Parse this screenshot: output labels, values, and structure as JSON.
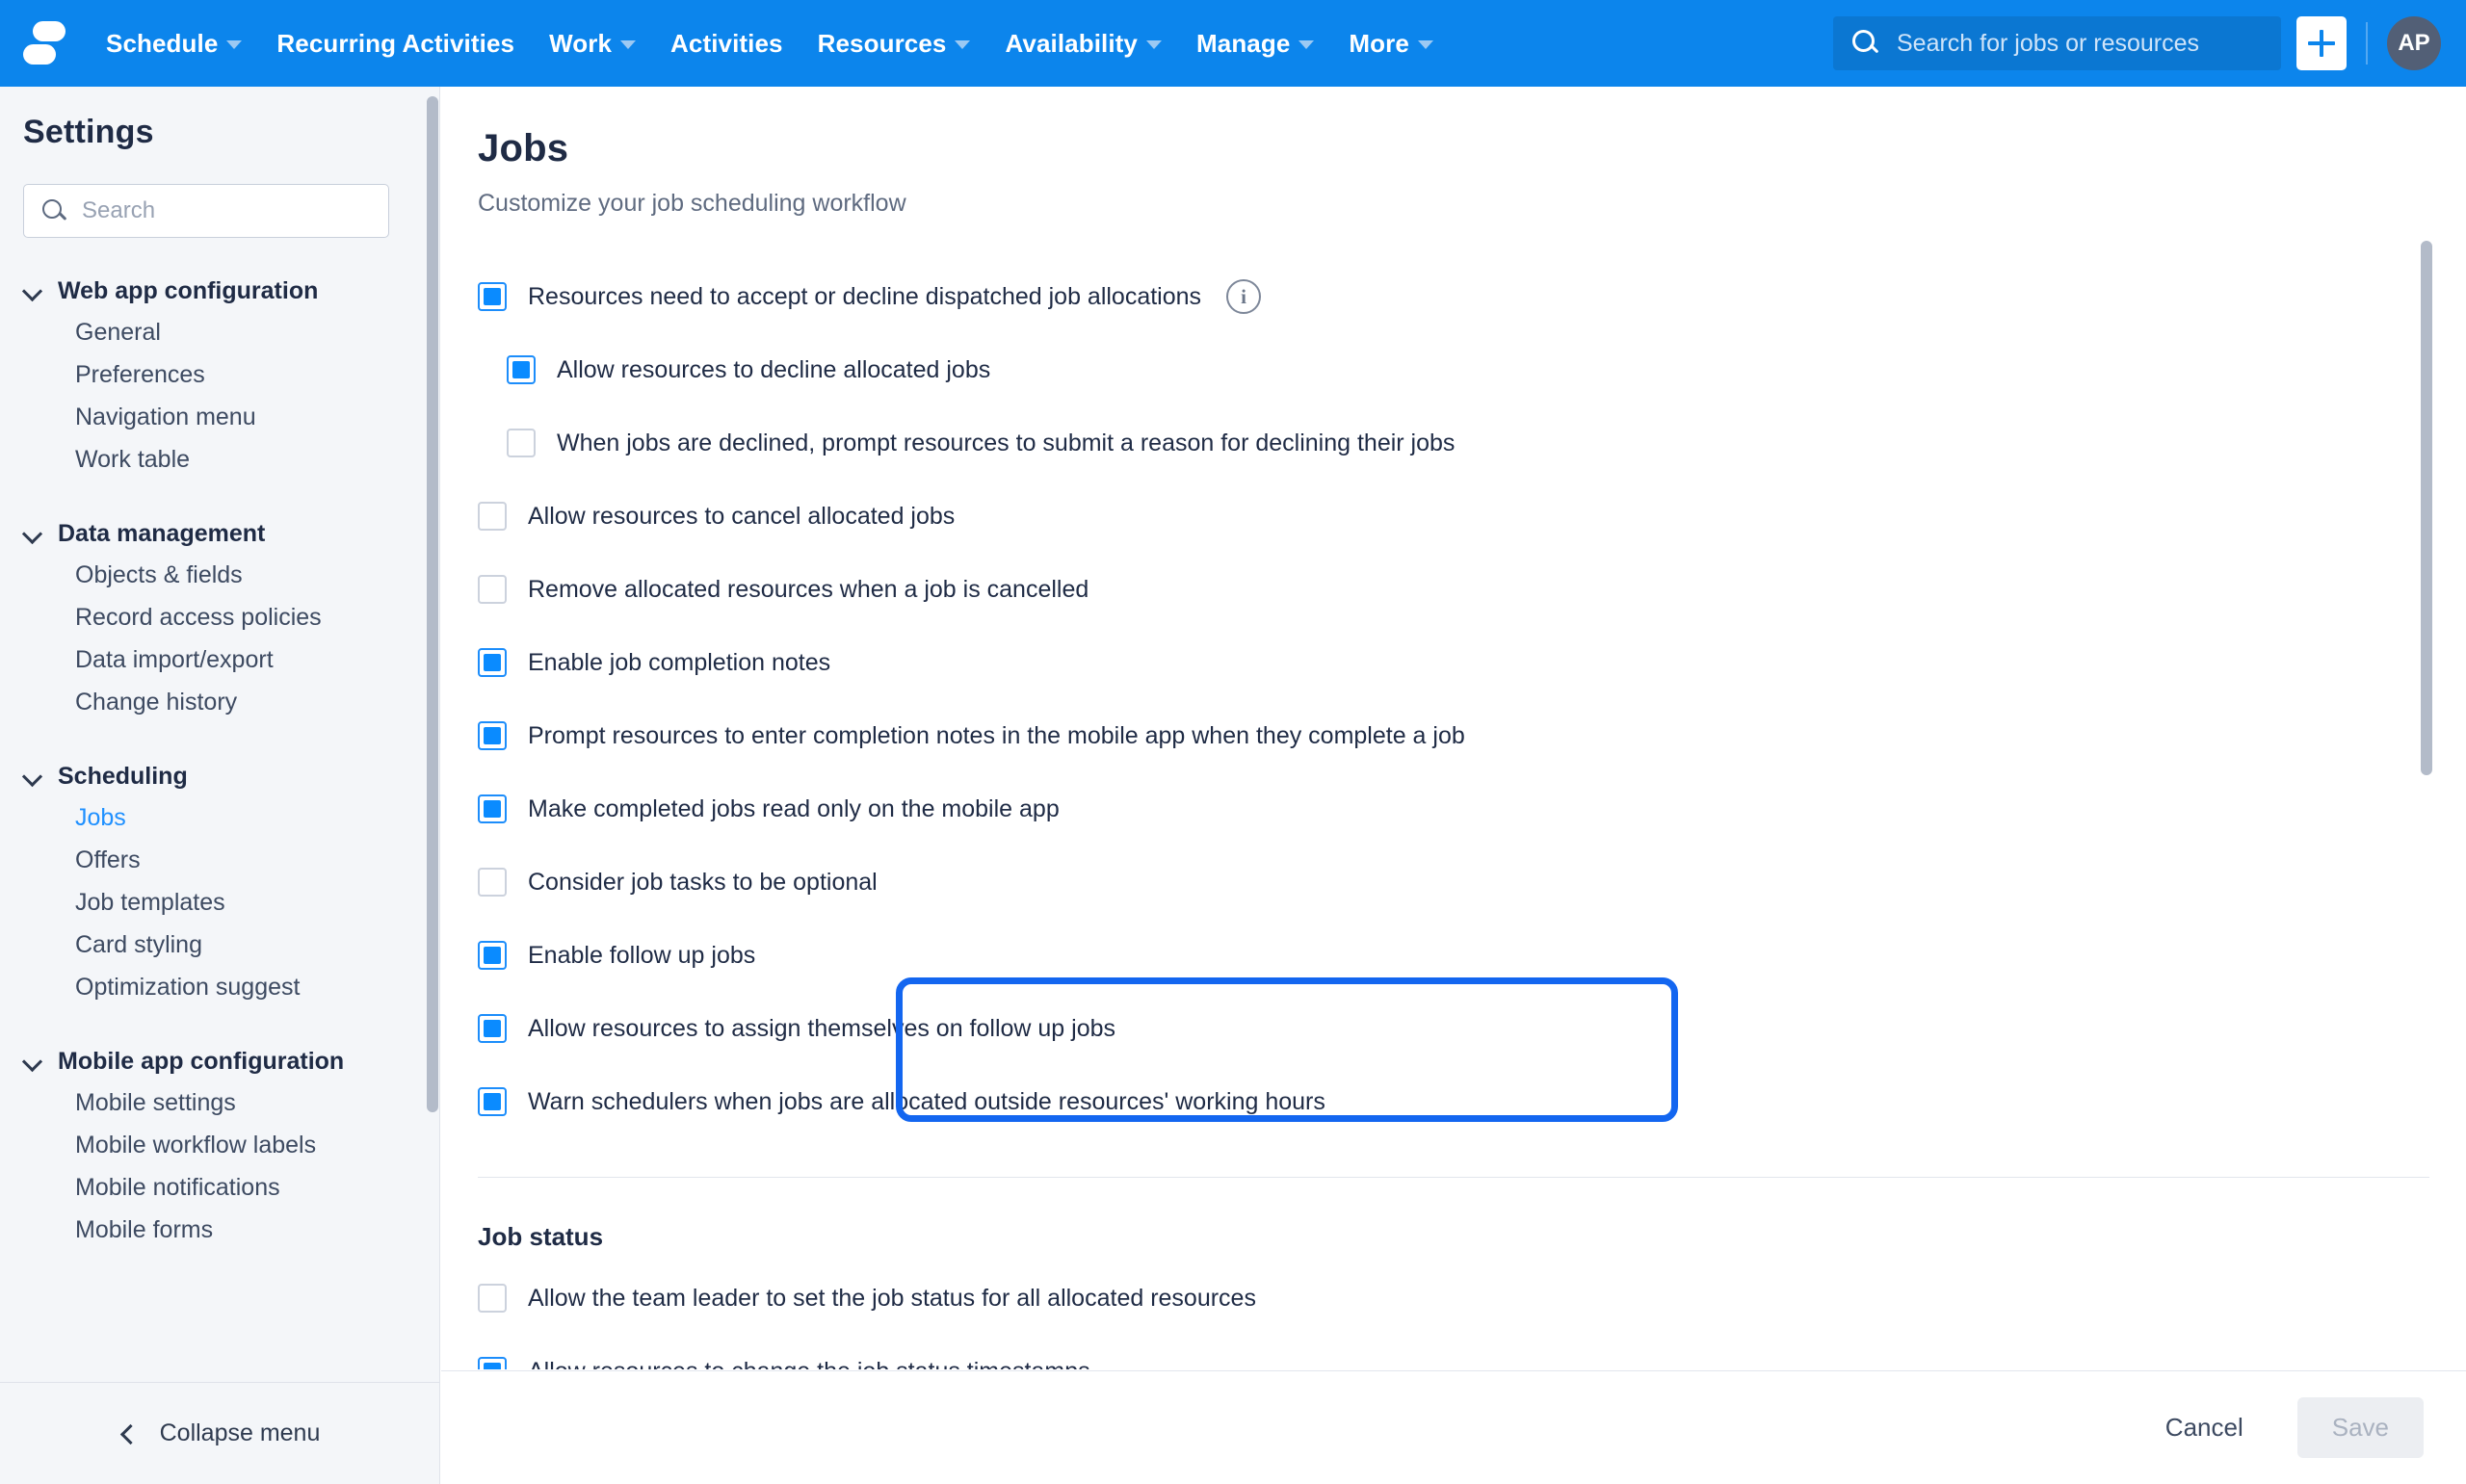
{
  "topnav": {
    "logo_name": "skedulo-logo",
    "items": [
      {
        "label": "Schedule",
        "has_caret": true
      },
      {
        "label": "Recurring Activities",
        "has_caret": false
      },
      {
        "label": "Work",
        "has_caret": true
      },
      {
        "label": "Activities",
        "has_caret": false
      },
      {
        "label": "Resources",
        "has_caret": true
      },
      {
        "label": "Availability",
        "has_caret": true
      },
      {
        "label": "Manage",
        "has_caret": true
      },
      {
        "label": "More",
        "has_caret": true
      }
    ],
    "search_placeholder": "Search for jobs or resources",
    "search_value": "",
    "add_button_label": "+",
    "avatar_initials": "AP",
    "brand_color": "#0c85ec"
  },
  "sidebar": {
    "title": "Settings",
    "search_placeholder": "Search",
    "search_value": "",
    "groups": [
      {
        "label": "Web app configuration",
        "items": [
          {
            "label": "General",
            "active": false
          },
          {
            "label": "Preferences",
            "active": false
          },
          {
            "label": "Navigation menu",
            "active": false
          },
          {
            "label": "Work table",
            "active": false
          }
        ]
      },
      {
        "label": "Data management",
        "items": [
          {
            "label": "Objects & fields",
            "active": false
          },
          {
            "label": "Record access policies",
            "active": false
          },
          {
            "label": "Data import/export",
            "active": false
          },
          {
            "label": "Change history",
            "active": false
          }
        ]
      },
      {
        "label": "Scheduling",
        "items": [
          {
            "label": "Jobs",
            "active": true
          },
          {
            "label": "Offers",
            "active": false
          },
          {
            "label": "Job templates",
            "active": false
          },
          {
            "label": "Card styling",
            "active": false
          },
          {
            "label": "Optimization suggest",
            "active": false
          }
        ]
      },
      {
        "label": "Mobile app configuration",
        "items": [
          {
            "label": "Mobile settings",
            "active": false
          },
          {
            "label": "Mobile workflow labels",
            "active": false
          },
          {
            "label": "Mobile notifications",
            "active": false
          },
          {
            "label": "Mobile forms",
            "active": false
          }
        ]
      }
    ],
    "collapse_label": "Collapse menu"
  },
  "main": {
    "title": "Jobs",
    "subtitle": "Customize your job scheduling workflow",
    "options": [
      {
        "label": "Resources need to accept or decline dispatched job allocations",
        "checked": true,
        "indent": false,
        "info": true
      },
      {
        "label": "Allow resources to decline allocated jobs",
        "checked": true,
        "indent": true,
        "info": false
      },
      {
        "label": "When jobs are declined, prompt resources to submit a reason for declining their jobs",
        "checked": false,
        "indent": true,
        "info": false
      },
      {
        "label": "Allow resources to cancel allocated jobs",
        "checked": false,
        "indent": false,
        "info": false
      },
      {
        "label": "Remove allocated resources when a job is cancelled",
        "checked": false,
        "indent": false,
        "info": false
      },
      {
        "label": "Enable job completion notes",
        "checked": true,
        "indent": false,
        "info": false
      },
      {
        "label": "Prompt resources to enter completion notes in the mobile app when they complete a job",
        "checked": true,
        "indent": false,
        "info": false
      },
      {
        "label": "Make completed jobs read only on the mobile app",
        "checked": true,
        "indent": false,
        "info": false
      },
      {
        "label": "Consider job tasks to be optional",
        "checked": false,
        "indent": false,
        "info": false
      },
      {
        "label": "Enable follow up jobs",
        "checked": true,
        "indent": false,
        "info": false
      },
      {
        "label": "Allow resources to assign themselves on follow up jobs",
        "checked": true,
        "indent": false,
        "info": false
      },
      {
        "label": "Warn schedulers when jobs are allocated outside resources' working hours",
        "checked": true,
        "indent": false,
        "info": false
      }
    ],
    "job_status_heading": "Job status",
    "job_status_options": [
      {
        "label": "Allow the team leader to set the job status for all allocated resources",
        "checked": false
      },
      {
        "label": "Allow resources to change the job status timestamps",
        "checked": true
      }
    ],
    "highlight_color": "#1366f0"
  },
  "footer": {
    "cancel_label": "Cancel",
    "save_label": "Save"
  }
}
